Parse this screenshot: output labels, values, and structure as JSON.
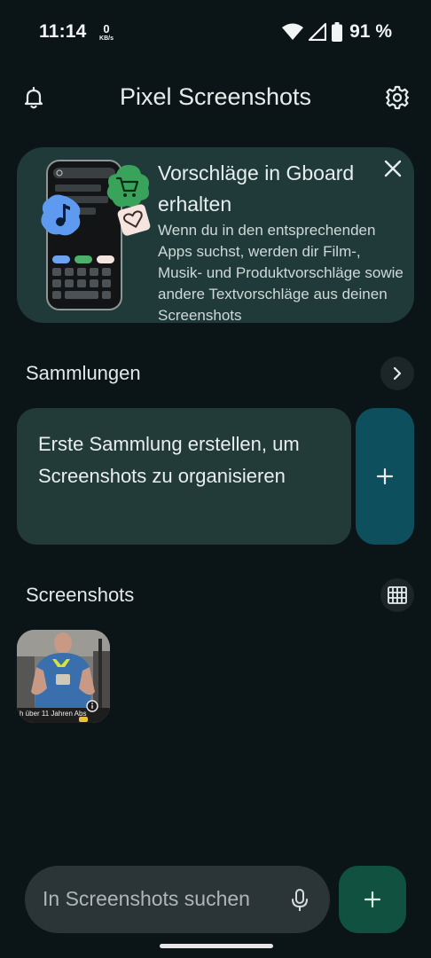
{
  "status_bar": {
    "time": "11:14",
    "net_speed_value": "0",
    "net_speed_unit": "KB/s",
    "battery_percent": "91 %",
    "icons": [
      "wifi-icon",
      "cell-signal-icon",
      "battery-icon"
    ]
  },
  "app_bar": {
    "title": "Pixel Screenshots",
    "left_icon": "bell-icon",
    "right_icon": "gear-icon"
  },
  "promo_card": {
    "title": "Vorschläge in Gboard erhalten",
    "body": "Wenn du in den entsprechenden Apps suchst, werden dir Film-, Musik- und Produktvorschläge sowie andere Textvorschläge aus deinen Screenshots"
  },
  "collections": {
    "title": "Sammlungen",
    "empty_text": "Erste Sammlung erstellen, um Screenshots zu organisieren"
  },
  "screenshots": {
    "title": "Screenshots",
    "thumb_caption": "h über 11 Jahren Abs"
  },
  "search": {
    "placeholder": "In Screenshots suchen"
  },
  "colors": {
    "background": "#0b1416",
    "promo_card": "#1f3a39",
    "collection_card": "#223a38",
    "add_collection": "#0e4f5e",
    "fab": "#10523f",
    "search": "#2b3436"
  }
}
